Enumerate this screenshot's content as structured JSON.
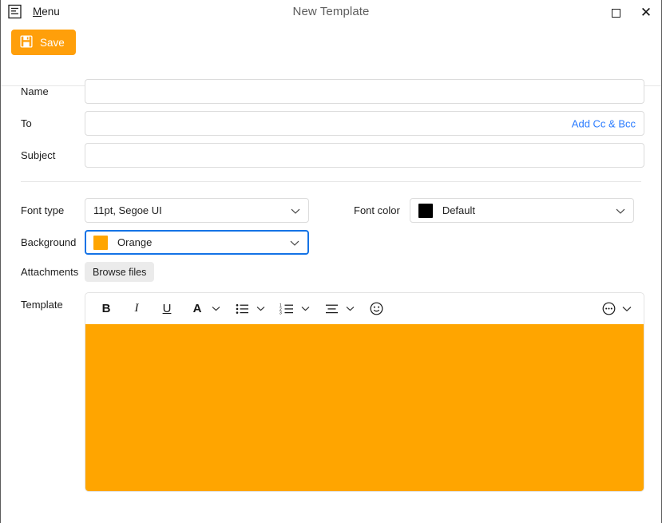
{
  "window": {
    "title": "New Template",
    "menu_icon": "document-list-icon",
    "menu_label_accel": "M",
    "menu_label_rest": "enu",
    "controls": {
      "maximize": "maximize-icon",
      "close": "✕"
    }
  },
  "toolbar": {
    "save_label": "Save",
    "save_icon": "floppy-disk-save-icon",
    "save_color": "#FF9F0A"
  },
  "form": {
    "fields": [
      {
        "label": "Name",
        "value": "",
        "placeholder": ""
      },
      {
        "label": "To",
        "value": "",
        "placeholder": ""
      },
      {
        "label": "Subject",
        "value": "",
        "placeholder": ""
      }
    ],
    "add_cc_bcc_label": "Add Cc & Bcc",
    "add_cc_bcc_color": "#2b7cff"
  },
  "options": {
    "font_type": {
      "label": "Font type",
      "value": "11pt, Segoe UI"
    },
    "font_color": {
      "label": "Font color",
      "value": "Default",
      "swatch": "#000000"
    },
    "background": {
      "label": "Background",
      "value": "Orange",
      "swatch": "#FFA500",
      "focus_color": "#1473E6"
    },
    "attachments": {
      "label": "Attachments",
      "browse_label": "Browse files"
    }
  },
  "editor": {
    "label": "Template",
    "body_color": "#FFA500",
    "body_text": "",
    "toolbar_buttons": [
      {
        "name": "bold-icon",
        "glyph": "B"
      },
      {
        "name": "italic-icon",
        "glyph": "I"
      },
      {
        "name": "underline-icon",
        "glyph": "U"
      },
      {
        "name": "font-color-icon",
        "glyph": "A"
      },
      {
        "name": "font-color-chevron-icon",
        "glyph": "⌄"
      },
      {
        "name": "bullet-list-icon",
        "glyph": ""
      },
      {
        "name": "bullet-list-chevron-icon",
        "glyph": "⌄"
      },
      {
        "name": "numbered-list-icon",
        "glyph": ""
      },
      {
        "name": "numbered-list-chevron-icon",
        "glyph": "⌄"
      },
      {
        "name": "align-icon",
        "glyph": ""
      },
      {
        "name": "align-chevron-icon",
        "glyph": "⌄"
      },
      {
        "name": "emoji-icon",
        "glyph": "☺"
      },
      {
        "name": "more-options-icon",
        "glyph": "···"
      },
      {
        "name": "more-options-chevron-icon",
        "glyph": "⌄"
      }
    ]
  }
}
